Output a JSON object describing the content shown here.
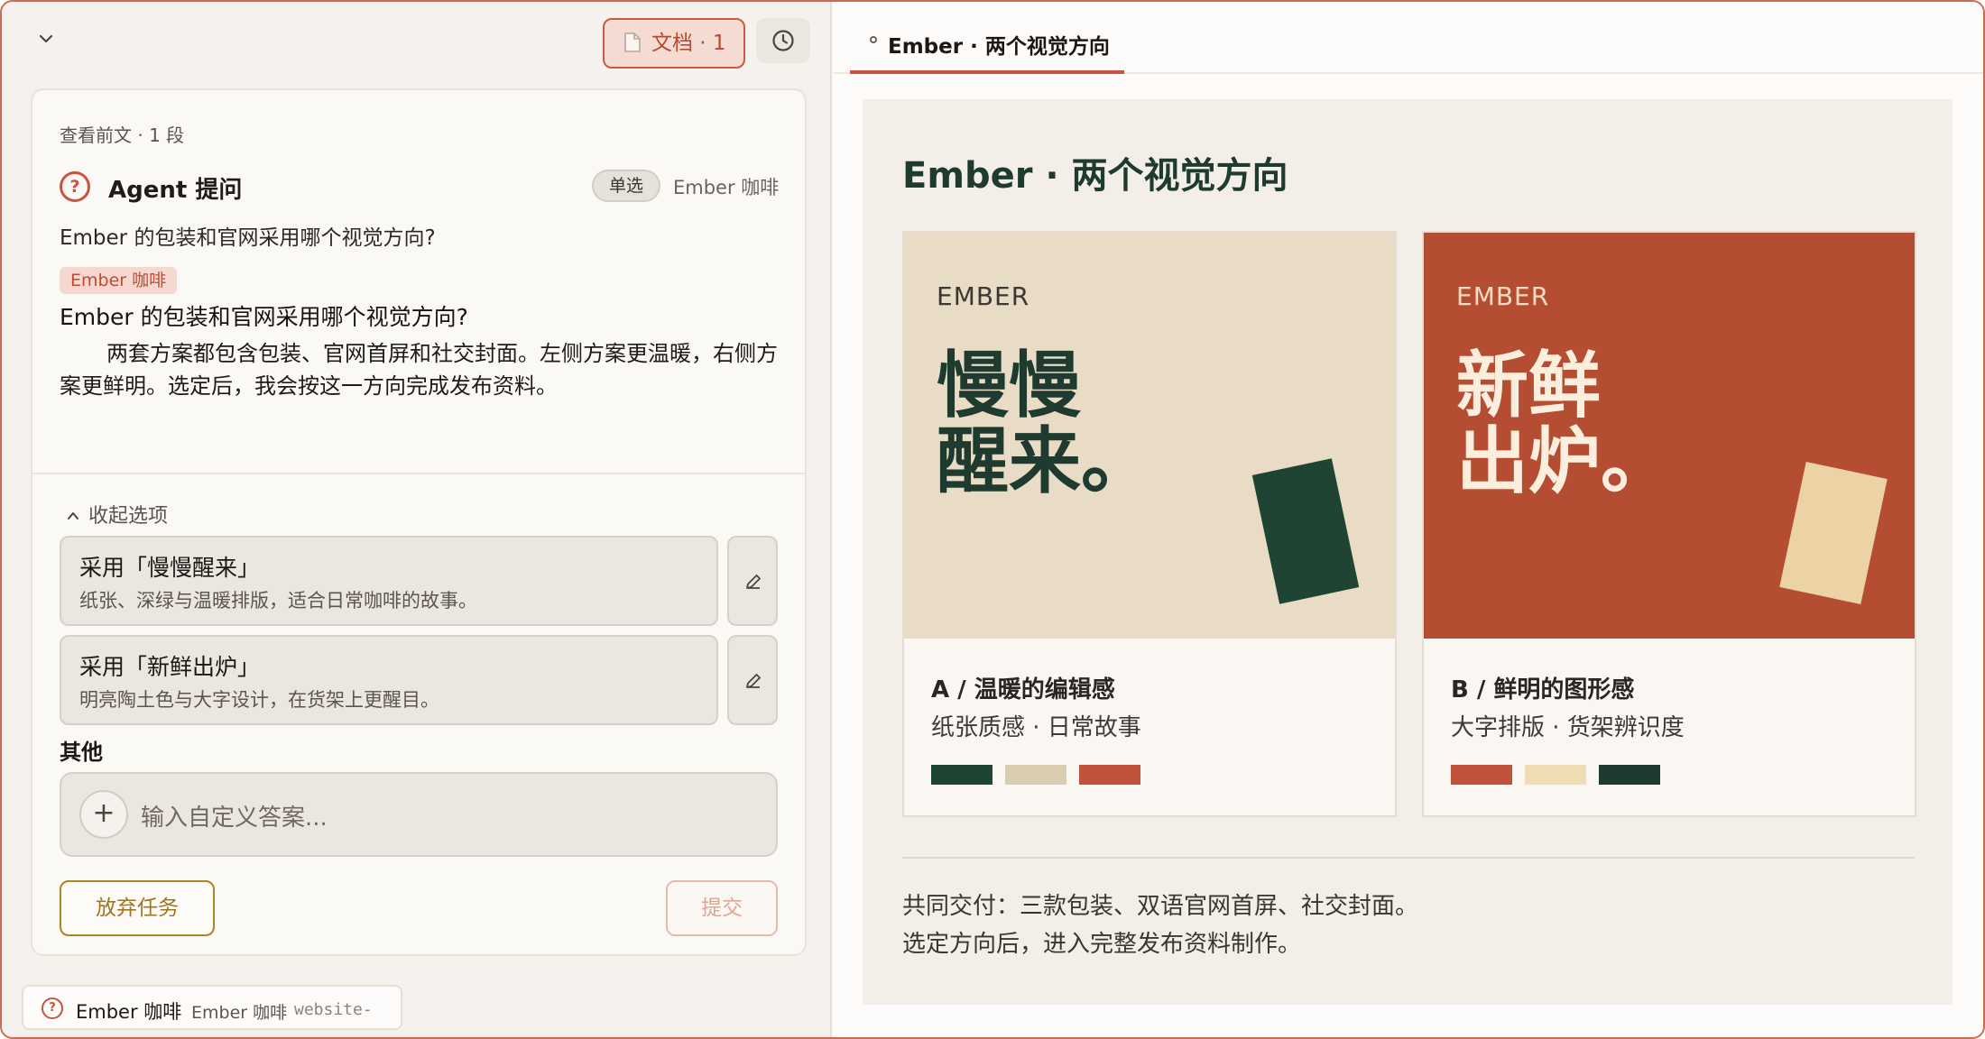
{
  "left_panel": {
    "doc_button": "文档 · 1",
    "context_link": "查看前文 · 1 段",
    "question": {
      "heading": "Agent 提问",
      "mode_pill": "单选",
      "project": "Ember 咖啡",
      "text": "Ember 的包装和官网采用哪个视觉方向?",
      "tag": "Ember 咖啡",
      "bold_text": "Ember 的包装和官网采用哪个视觉方向?",
      "paragraph": "两套方案都包含包装、官网首屏和社交封面。左侧方案更温暖，右侧方案更鲜明。选定后，我会按这一方向完成发布资料。"
    },
    "collapse_label": "收起选项",
    "options": [
      {
        "title": "采用「慢慢醒来」",
        "desc": "纸张、深绿与温暖排版，适合日常咖啡的故事。"
      },
      {
        "title": "采用「新鲜出炉」",
        "desc": "明亮陶土色与大字设计，在货架上更醒目。"
      }
    ],
    "other_label": "其他",
    "custom_placeholder": "输入自定义答案...",
    "abandon_button": "放弃任务",
    "submit_button": "提交"
  },
  "bottom_tab": {
    "name": "Ember 咖啡",
    "project": "Ember 咖啡",
    "file": "website-"
  },
  "right_panel": {
    "tab_label": "Ember · 两个视觉方向",
    "preview": {
      "title": "Ember · 两个视觉方向",
      "cards": [
        {
          "brand": "EMBER",
          "headline_1": "慢慢",
          "headline_2": "醒来。",
          "label": "A / 温暖的编辑感",
          "sub": "纸张质感 · 日常故事",
          "bg": "#e8dcc6",
          "text_color": "#1f3a2e",
          "accent": "#1f4433",
          "swatches": [
            "#1f4433",
            "#d9ccb0",
            "#c0513a"
          ]
        },
        {
          "brand": "EMBER",
          "headline_1": "新鲜",
          "headline_2": "出炉。",
          "label": "B / 鲜明的图形感",
          "sub": "大字排版 · 货架辨识度",
          "bg": "#b54d33",
          "text_color": "#fbeedd",
          "accent": "#ecd3a6",
          "swatches": [
            "#c0513a",
            "#efddb4",
            "#1f3a2e"
          ]
        }
      ],
      "footer_line_1": "共同交付：三款包装、双语官网首屏、社交封面。",
      "footer_line_2": "选定方向后，进入完整发布资料制作。"
    }
  }
}
